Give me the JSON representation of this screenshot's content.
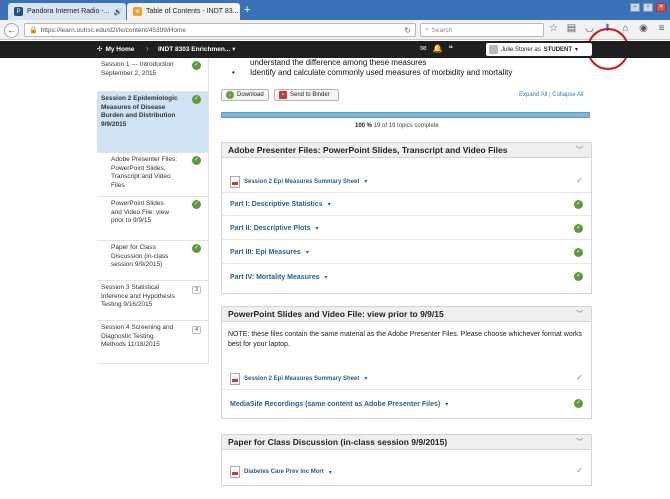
{
  "browser": {
    "tabs": [
      {
        "title": "Pandora Internet Radio -...",
        "icon": "pandora-icon",
        "audio_icon": "speaker-icon"
      },
      {
        "title": "Table of Contents - INDT 83...",
        "icon": "star-icon"
      }
    ],
    "url": "https://learn.ouhsc.edu/d2l/le/content/45399/Home",
    "search_placeholder": "Search",
    "new_tab_symbol": "+"
  },
  "d2l": {
    "home_label": "My Home",
    "course_label": "INDT 8303 Enrichmen...",
    "user_name": "Julie Stoner as",
    "user_role": "STUDENT"
  },
  "leftnav": {
    "items": [
      {
        "label": "Session 1 --- Introduction September 2, 2015",
        "status": "✓"
      },
      {
        "label": "Session 2 Epidemiologic Measures of Disease Burden and Distribution 9/9/2015",
        "status": "✓"
      },
      {
        "label": "Adobe Presenter Files: PowerPoint Slides, Transcript and Video Files",
        "status": "✓"
      },
      {
        "label": "PowerPoint Slides and Video File: view prior to 9/9/15",
        "status": "✓"
      },
      {
        "label": "Paper for Class Discussion (in-class session 9/9/2015)",
        "status": "✓"
      },
      {
        "label": "Session 3 Statistical Inference and Hypothesis Testing 9/16/2015",
        "count": "3"
      },
      {
        "label": "Session 4 Screening and Diagnostic Testing Methods 11/18/2015",
        "count": "4"
      }
    ]
  },
  "objectives": {
    "line1": "understand the difference among these measures",
    "line2": "Identify and calculate commonly used measures of morbidity and mortality",
    "bullet": "•"
  },
  "toolbar": {
    "download_label": "Download",
    "binder_label": "Send to Binder",
    "expand_all": "Expand All",
    "collapse_all": "Collapse All",
    "separator": "|"
  },
  "progress": {
    "percent_label": "100 %",
    "detail": "19 of 19 topics complete",
    "fraction": 1.0
  },
  "modules": [
    {
      "title": "Adobe Presenter Files: PowerPoint Slides, Transcript and Video Files",
      "topics": [
        {
          "label": "Session 2 Epi Measures Summary Sheet",
          "status": "✓"
        },
        {
          "label": "Part I: Descriptive Statistics",
          "status": "✓"
        },
        {
          "label": "Part II: Descriptive Plots",
          "status": "✓"
        },
        {
          "label": "Part III: Epi Measures",
          "status": "✓"
        },
        {
          "label": "Part IV: Mortality Measures",
          "status": "✓"
        }
      ]
    },
    {
      "title": "PowerPoint Slides and Video File: view prior to 9/9/15",
      "note": "NOTE:  these files contain the same material as the Adobe Presenter Files.  Please choose whichever format works best for your laptop.",
      "topics": [
        {
          "label": "Session 2 Epi Measures Summary Sheet",
          "status": "✓"
        },
        {
          "label": "MediaSite Recordings (same content as Adobe Presenter Files)",
          "status": "✓"
        }
      ]
    },
    {
      "title": "Paper for Class Discussion (in-class session 9/9/2015)",
      "topics": [
        {
          "label": "Diabetes Care Prev Inc Mort",
          "status": "✓"
        }
      ]
    }
  ],
  "colors": {
    "tabbar": "#3a71b8",
    "d2l_bar": "#1f1f1f",
    "link": "#2a5f8e",
    "complete_green": "#5d9b3a",
    "selected_nav": "#cfe3f4",
    "annotation_red": "#d0141b"
  }
}
